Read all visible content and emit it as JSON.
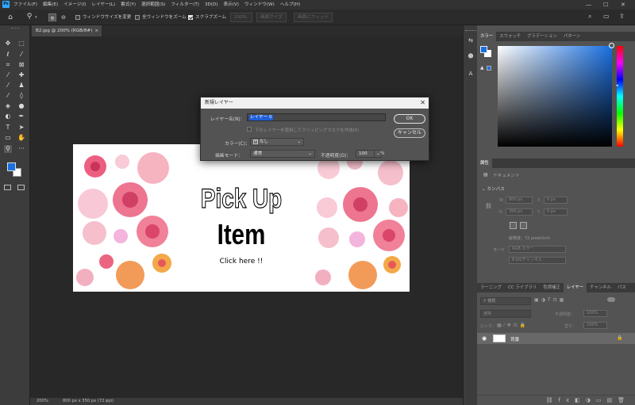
{
  "menu": {
    "logo": "Ps",
    "items": [
      "ファイル(F)",
      "編集(E)",
      "イメージ(I)",
      "レイヤー(L)",
      "書式(Y)",
      "選択範囲(S)",
      "フィルター(T)",
      "3D(D)",
      "表示(V)",
      "ウィンドウ(W)",
      "ヘルプ(H)"
    ]
  },
  "options": {
    "resize_windows": "ウィンドウサイズを変更",
    "zoom_all": "全ウィンドウをズーム",
    "scrubby": "スクラブズーム",
    "zoom_pct": "100%",
    "fit_screen": "画面サイズ",
    "fill_screen": "画面にフィット"
  },
  "document": {
    "tab": "B2.jpg @ 200% (RGB/8#)",
    "zoom": "200%",
    "info": "800 px x 350 px (72 ppi)"
  },
  "artwork": {
    "line1": "Pick Up",
    "line2": "Item",
    "line3": "Click here !!"
  },
  "dialog": {
    "title": "新規レイヤー",
    "name_label": "レイヤー名(N)：",
    "name_value": "レイヤー 0",
    "clip_label": "下のレイヤーを使用してクリッピングマスクを作成(P)",
    "color_label": "カラー(C)：",
    "color_value": "なし",
    "mode_label": "描画モード：",
    "mode_value": "通常",
    "opacity_label": "不透明度(O)：",
    "opacity_value": "100",
    "opacity_unit": "%",
    "ok": "OK",
    "cancel": "キャンセル"
  },
  "color_panel": {
    "tabs": [
      "カラー",
      "スウォッチ",
      "グラデーション",
      "パターン"
    ],
    "fg_color": "#1a6fe0"
  },
  "properties": {
    "tab": "属性",
    "doc_label": "ドキュメント",
    "canvas_label": "カンバス",
    "w": "W",
    "w_val": "800 px",
    "h": "H",
    "h_val": "350 px",
    "x": "X",
    "x_val": "0 px",
    "y": "Y",
    "y_val": "0 px",
    "resolution": "解像度：72 pixel/inch",
    "mode_label": "モード",
    "mode_val": "RGB カラー",
    "bits": "8 bit/チャンネル"
  },
  "layers": {
    "tabs": [
      "ラーニング",
      "CC ライブラリ",
      "色調補正",
      "レイヤー",
      "チャンネル",
      "パス"
    ],
    "kind": "種類",
    "blend": "通常",
    "opacity_label": "不透明度：",
    "opacity_val": "100%",
    "lock_label": "ロック：",
    "fill_label": "塗り：",
    "fill_val": "100%",
    "layer_name": "背景"
  }
}
